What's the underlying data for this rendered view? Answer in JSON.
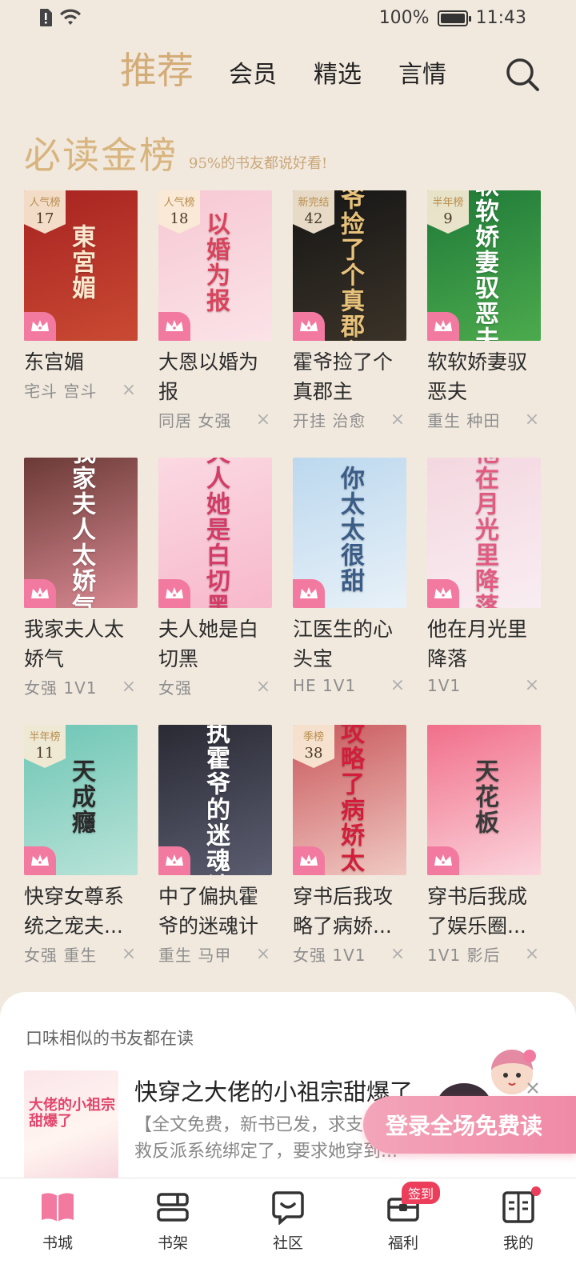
{
  "status_bar": {
    "battery": "100%",
    "time": "11:43",
    "battery_level": 1.0
  },
  "top_nav": {
    "tabs": [
      "推荐",
      "会员",
      "精选",
      "言情"
    ],
    "active": 0
  },
  "section": {
    "title": "必读金榜",
    "subtitle": "95%的书友都说好看!"
  },
  "books": [
    {
      "title": "东宫媚",
      "tags": "宅斗 宫斗",
      "rank_label": "人气榜",
      "rank": "17",
      "cover_title": "東宮媚",
      "cover_colors": [
        "#a72321",
        "#c94a33"
      ],
      "cover_text_color": "#fbe8cf"
    },
    {
      "title": "大恩以婚为报",
      "tags": "同居 女强",
      "rank_label": "人气榜",
      "rank": "18",
      "cover_title": "以婚为报",
      "cover_colors": [
        "#f7c8d3",
        "#fbe3e8"
      ],
      "cover_text_color": "#d9435b"
    },
    {
      "title": "霍爷捡了个真郡主",
      "tags": "开挂 治愈",
      "rank_label": "新完结",
      "rank": "42",
      "cover_title": "霍爷捡了个真郡主",
      "cover_colors": [
        "#161616",
        "#3b3328"
      ],
      "cover_text_color": "#e8c27a"
    },
    {
      "title": "软软娇妻驭恶夫",
      "tags": "重生 种田",
      "rank_label": "半年榜",
      "rank": "9",
      "cover_title": "软软娇妻驭恶夫",
      "cover_colors": [
        "#1f7a38",
        "#4caa4d"
      ],
      "cover_text_color": "#ffffff"
    },
    {
      "title": "我家夫人太娇气",
      "tags": "女强 1V1",
      "rank_label": "",
      "rank": "",
      "cover_title": "我家夫人太娇气",
      "cover_colors": [
        "#6b3a36",
        "#d98a93"
      ],
      "cover_text_color": "#ffffff"
    },
    {
      "title": "夫人她是白切黑",
      "tags": "女强",
      "rank_label": "",
      "rank": "",
      "cover_title": "夫人她是白切黑",
      "cover_colors": [
        "#fbd9e3",
        "#f7b8cb"
      ],
      "cover_text_color": "#d43b66"
    },
    {
      "title": "江医生的心头宝",
      "tags": "HE 1V1",
      "rank_label": "",
      "rank": "",
      "cover_title": "你太太很甜",
      "cover_colors": [
        "#bcd8ee",
        "#e8f1f8"
      ],
      "cover_text_color": "#3a5c86"
    },
    {
      "title": "他在月光里降落",
      "tags": "1V1",
      "rank_label": "",
      "rank": "",
      "cover_title": "他在月光里降落",
      "cover_colors": [
        "#f4d7e0",
        "#f9edf1"
      ],
      "cover_text_color": "#e25a80"
    },
    {
      "title": "快穿女尊系统之宠夫...",
      "tags": "女强 重生",
      "rank_label": "半年榜",
      "rank": "11",
      "cover_title": "天成癮",
      "cover_colors": [
        "#6ec6b5",
        "#b9e3d8"
      ],
      "cover_text_color": "#2a2a2a"
    },
    {
      "title": "中了偏执霍爷的迷魂计",
      "tags": "重生 马甲",
      "rank_label": "",
      "rank": "",
      "cover_title": "偏执霍爷的迷魂计",
      "cover_colors": [
        "#2a2a34",
        "#5b5d70"
      ],
      "cover_text_color": "#ffffff"
    },
    {
      "title": "穿书后我攻略了病娇...",
      "tags": "女强 1V1",
      "rank_label": "季榜",
      "rank": "38",
      "cover_title": "我攻略了病娇太子",
      "cover_colors": [
        "#c9575c",
        "#f0c9c2"
      ],
      "cover_text_color": "#d21e3a"
    },
    {
      "title": "穿书后我成了娱乐圈...",
      "tags": "1V1 影后",
      "rank_label": "",
      "rank": "",
      "cover_title": "天花板",
      "cover_colors": [
        "#f16f8a",
        "#fbd5dd"
      ],
      "cover_text_color": "#3a3a3a"
    }
  ],
  "similar": {
    "header": "口味相似的书友都在读",
    "title": "快穿之大佬的小祖宗甜爆了",
    "description": "【全文免费，新书已发，求支持】洁1v1 时柚被拯救反派系统绑定了，要求她穿到...",
    "cover_title": "大佬的小祖宗甜爆了",
    "login_button": "登录全场免费读"
  },
  "bottom_nav": {
    "items": [
      "书城",
      "书架",
      "社区",
      "福利",
      "我的"
    ],
    "active": 0,
    "welfare_badge": "签到"
  },
  "colors": {
    "accent": "#d4ac78",
    "pink": "#f27aa1",
    "background": "#f1e9de"
  }
}
